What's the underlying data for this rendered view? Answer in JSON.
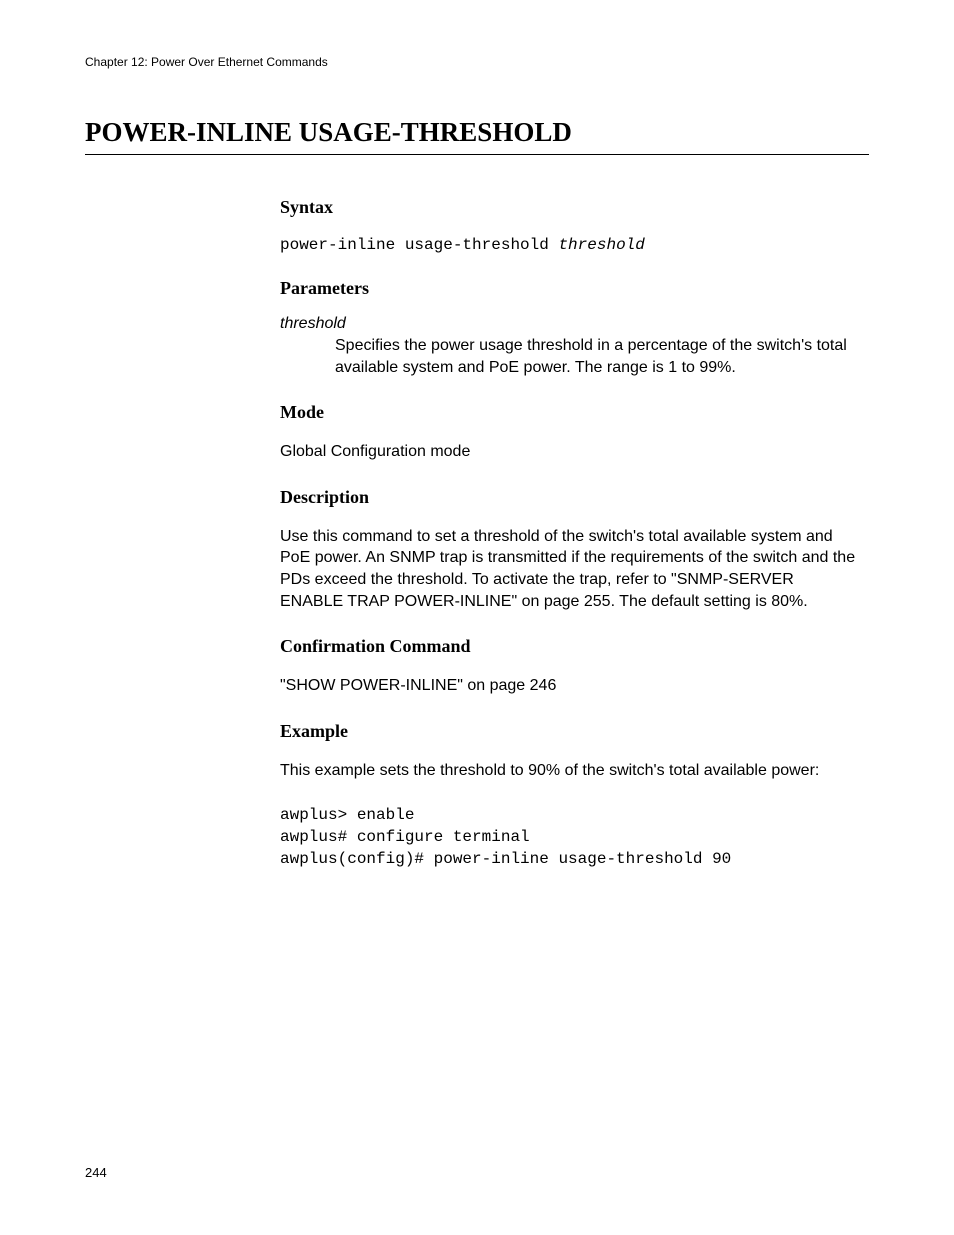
{
  "chapter_header": "Chapter 12: Power Over Ethernet Commands",
  "title": "POWER-INLINE USAGE-THRESHOLD",
  "syntax": {
    "heading": "Syntax",
    "command": "power-inline usage-threshold ",
    "arg": "threshold"
  },
  "parameters": {
    "heading": "Parameters",
    "name": "threshold",
    "desc": "Specifies the power usage threshold in a percentage of the switch's total available system and PoE power. The range is 1 to 99%."
  },
  "mode": {
    "heading": "Mode",
    "text": "Global Configuration mode"
  },
  "description": {
    "heading": "Description",
    "text": "Use this command to set a threshold of the switch's total available system and PoE power. An SNMP trap is transmitted if the requirements of the switch and the PDs exceed the threshold. To activate the trap, refer to \"SNMP-SERVER ENABLE TRAP POWER-INLINE\" on page 255. The default setting is 80%."
  },
  "confirmation": {
    "heading": "Confirmation Command",
    "text": "\"SHOW POWER-INLINE\" on page 246"
  },
  "example": {
    "heading": "Example",
    "intro": "This example sets the threshold to 90% of the switch's total available power:",
    "code": "awplus> enable\nawplus# configure terminal\nawplus(config)# power-inline usage-threshold 90"
  },
  "page_number": "244"
}
